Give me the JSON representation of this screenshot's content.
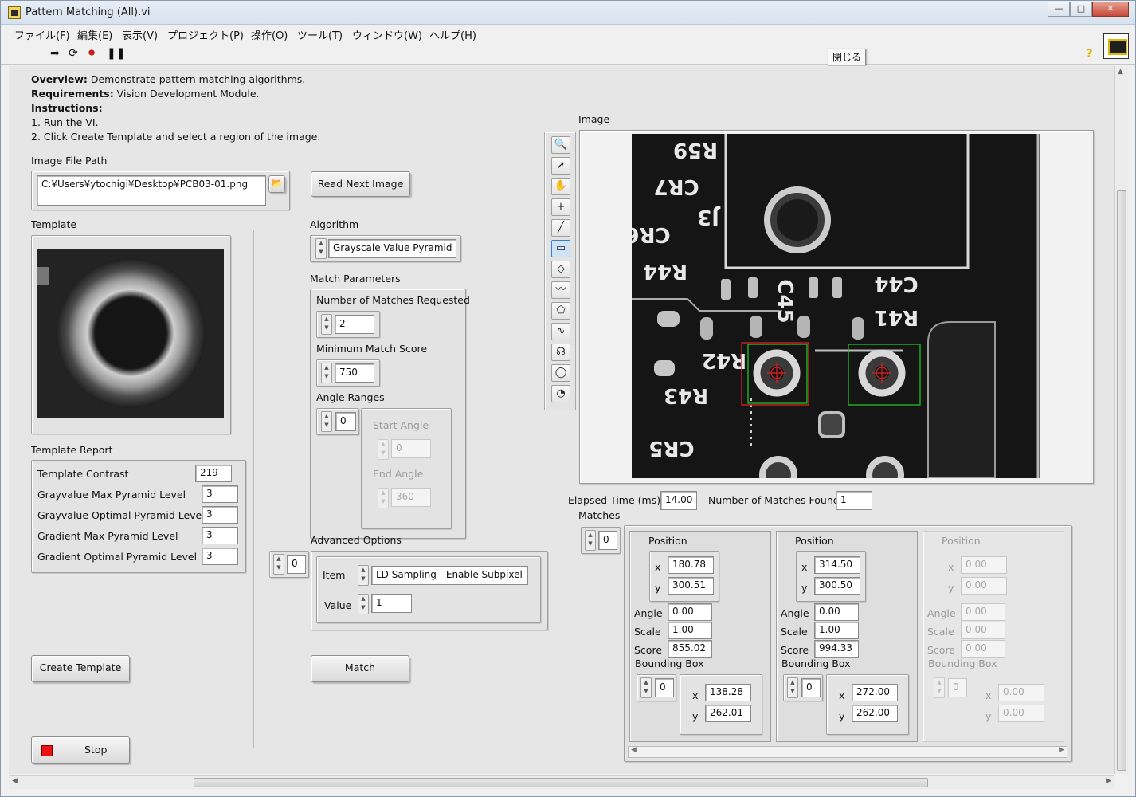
{
  "window": {
    "title": "Pattern Matching (All).vi",
    "minimize": "—",
    "maximize": "□",
    "close": "✕"
  },
  "menu": [
    "ファイル(F)",
    "編集(E)",
    "表示(V)",
    "プロジェクト(P)",
    "操作(O)",
    "ツール(T)",
    "ウィンドウ(W)",
    "ヘルプ(H)"
  ],
  "toolbar": {
    "close_tooltip": "閉じる",
    "help": "?"
  },
  "overview": {
    "overview_label": "Overview:",
    "overview_text": " Demonstrate pattern matching algorithms.",
    "requirements_label": "Requirements:",
    "requirements_text": " Vision Development Module.",
    "instructions_label": "Instructions:",
    "step1": "1. Run the VI.",
    "step2": "2. Click Create Template and select a region of the image."
  },
  "image_file_path": {
    "label": "Image File Path",
    "value": "C:¥Users¥ytochigi¥Desktop¥PCB03-01.png"
  },
  "read_next_image": "Read Next Image",
  "template": {
    "label": "Template"
  },
  "algorithm": {
    "label": "Algorithm",
    "value": "Grayscale Value Pyramid"
  },
  "match_parameters": {
    "label": "Match Parameters",
    "num_matches_label": "Number of Matches Requested",
    "num_matches": "2",
    "min_score_label": "Minimum Match Score",
    "min_score": "750",
    "angle_ranges_label": "Angle Ranges",
    "angle_index": "0",
    "start_angle_label": "Start Angle",
    "start_angle": "0",
    "end_angle_label": "End Angle",
    "end_angle": "360"
  },
  "template_report": {
    "label": "Template Report",
    "rows": [
      {
        "name": "Template Contrast",
        "value": "219"
      },
      {
        "name": "Grayvalue Max Pyramid Level",
        "value": "3"
      },
      {
        "name": "Grayvalue Optimal Pyramid Level",
        "value": "3"
      },
      {
        "name": "Gradient Max Pyramid Level",
        "value": "3"
      },
      {
        "name": "Gradient Optimal Pyramid Level",
        "value": "3"
      }
    ]
  },
  "advanced_options": {
    "label": "Advanced Options",
    "index": "0",
    "item_label": "Item",
    "item_value": "LD Sampling - Enable Subpixel",
    "value_label": "Value",
    "value": "1"
  },
  "buttons": {
    "create_template": "Create Template",
    "match": "Match",
    "stop": "Stop"
  },
  "image_display": {
    "label": "Image",
    "pcb_labels": [
      "R59",
      "CR7",
      "J3",
      "CR6",
      "R44",
      "C45",
      "C44",
      "R41",
      "R42",
      "R43",
      "CR5"
    ]
  },
  "elapsed_time": {
    "label": "Elapsed Time (ms)",
    "value": "14.00"
  },
  "matches_found": {
    "label": "Number of Matches Found",
    "value": "1"
  },
  "matches": {
    "label": "Matches",
    "index": "0",
    "columns": [
      {
        "position_label": "Position",
        "x": "180.78",
        "y": "300.51",
        "angle_label": "Angle",
        "angle": "0.00",
        "scale_label": "Scale",
        "scale": "1.00",
        "score_label": "Score",
        "score": "855.02",
        "bbox_label": "Bounding Box",
        "bbox_index": "0",
        "bx": "138.28",
        "by": "262.01"
      },
      {
        "position_label": "Position",
        "x": "314.50",
        "y": "300.50",
        "angle_label": "Angle",
        "angle": "0.00",
        "scale_label": "Scale",
        "scale": "1.00",
        "score_label": "Score",
        "score": "994.33",
        "bbox_label": "Bounding Box",
        "bbox_index": "0",
        "bx": "272.00",
        "by": "262.00"
      },
      {
        "position_label": "Position",
        "x": "0.00",
        "y": "0.00",
        "angle_label": "Angle",
        "angle": "0.00",
        "scale_label": "Scale",
        "scale": "0.00",
        "score_label": "Score",
        "score": "0.00",
        "bbox_label": "Bounding Box",
        "bbox_index": "0",
        "bx": "0.00",
        "by": "0.00"
      }
    ],
    "x_axis_label": "x",
    "y_axis_label": "y"
  }
}
